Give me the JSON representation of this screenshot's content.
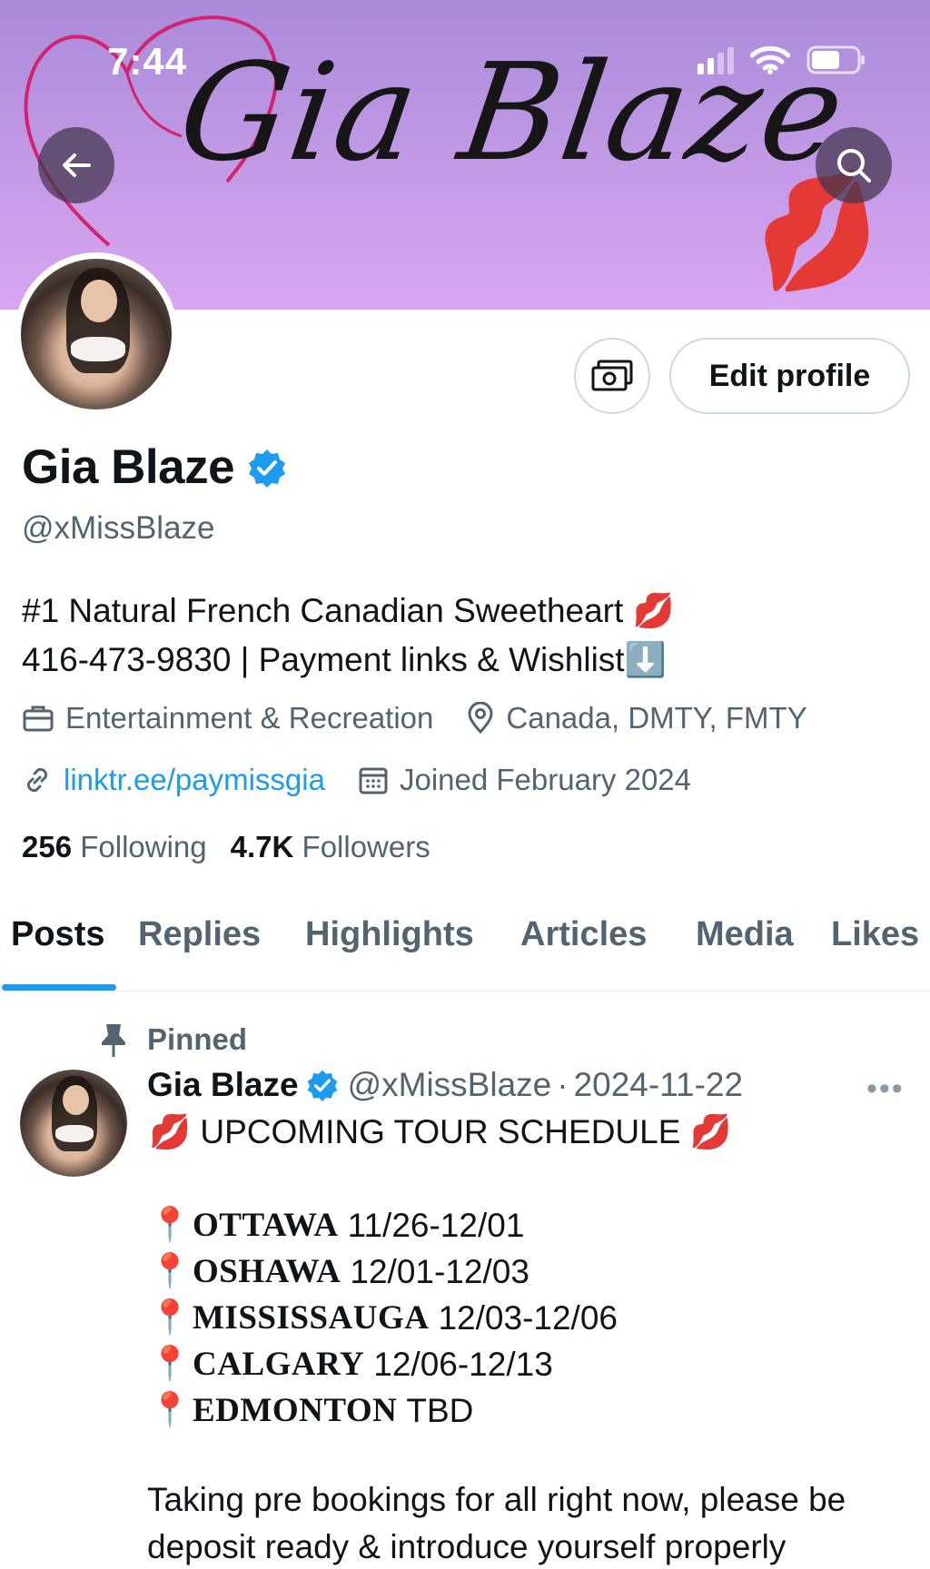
{
  "status_bar": {
    "time": "7:44"
  },
  "banner": {
    "script_text": "Gia Blaze"
  },
  "profile": {
    "edit_label": "Edit profile",
    "name": "Gia Blaze",
    "handle": "@xMissBlaze",
    "bio_line1": "#1 Natural French Canadian Sweetheart 💋",
    "bio_line2": "416-473-9830 | Payment links & Wishlist⬇️",
    "category": "Entertainment & Recreation",
    "location": "Canada, DMTY, FMTY",
    "website": "linktr.ee/paymissgia",
    "joined": "Joined February 2024",
    "following_count": "256",
    "following_label": "Following",
    "followers_count": "4.7K",
    "followers_label": "Followers"
  },
  "tabs": [
    "Posts",
    "Replies",
    "Highlights",
    "Articles",
    "Media",
    "Likes"
  ],
  "post": {
    "pinned_label": "Pinned",
    "author": "Gia Blaze",
    "handle": "@xMissBlaze",
    "separator": "·",
    "date": "2024-11-22",
    "title": "💋 UPCOMING TOUR SCHEDULE 💋",
    "tour": [
      {
        "city": "OTTAWA",
        "dates": "11/26-12/01"
      },
      {
        "city": "OSHAWA",
        "dates": "12/01-12/03"
      },
      {
        "city": "MISSISSAUGA",
        "dates": "12/03-12/06"
      },
      {
        "city": "CALGARY",
        "dates": "12/06-12/13"
      },
      {
        "city": "EDMONTON",
        "dates": "TBD"
      }
    ],
    "footer_text": "Taking pre bookings for all right now, please be deposit ready & introduce yourself properly"
  },
  "colors": {
    "accent": "#1d9bf0",
    "secondary_text": "#536471",
    "banner": "#c39ae6"
  }
}
